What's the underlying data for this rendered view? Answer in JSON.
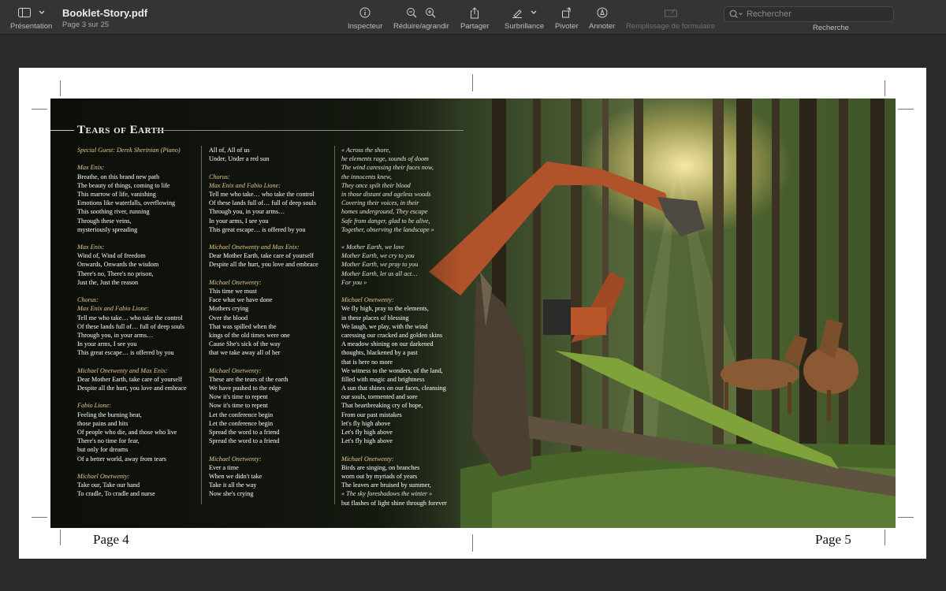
{
  "toolbar": {
    "presentation_label": "Présentation",
    "doc_title": "Booklet-Story.pdf",
    "doc_subtitle": "Page 3 sur 25",
    "inspector_label": "Inspecteur",
    "zoom_label": "Réduire/agrandir",
    "share_label": "Partager",
    "highlight_label": "Surbrillance",
    "rotate_label": "Pivoter",
    "annotate_label": "Annoter",
    "form_label": "Remplissage de formulaire",
    "search_placeholder": "Rechercher",
    "search_label": "Recherche"
  },
  "spread": {
    "title": "Tears of Earth",
    "col1": [
      {
        "t": "Special Guest: Derek Sherinian (Piano)",
        "s": "it"
      },
      {
        "t": "",
        "s": "gap"
      },
      {
        "t": "Max Enix:",
        "s": "it"
      },
      {
        "t": "Breathe, on this brand new path",
        "s": ""
      },
      {
        "t": "The beauty of things, coming to life",
        "s": ""
      },
      {
        "t": "This marrow of life, vanishing",
        "s": ""
      },
      {
        "t": "Emotions like waterfalls, overflowing",
        "s": ""
      },
      {
        "t": "This soothing river, running",
        "s": ""
      },
      {
        "t": "Through these veins,",
        "s": ""
      },
      {
        "t": "mysteriously spreading",
        "s": ""
      },
      {
        "t": "",
        "s": "gap"
      },
      {
        "t": "Max Enix:",
        "s": "it"
      },
      {
        "t": "Wind of, Wind of freedom",
        "s": ""
      },
      {
        "t": "Onwards, Onwards the wisdom",
        "s": ""
      },
      {
        "t": "There's no, There's no prison,",
        "s": ""
      },
      {
        "t": "Just the, Just the reason",
        "s": ""
      },
      {
        "t": "",
        "s": "gap"
      },
      {
        "t": "Chorus:",
        "s": "it"
      },
      {
        "t": "Max Enix and Fabio Lione:",
        "s": "it"
      },
      {
        "t": "Tell me who take… who take the control",
        "s": ""
      },
      {
        "t": "Of these lands full of… full of deep souls",
        "s": ""
      },
      {
        "t": "Through you, in your arms…",
        "s": ""
      },
      {
        "t": "In your arms, I see you",
        "s": ""
      },
      {
        "t": "This great escape… is offered by you",
        "s": ""
      },
      {
        "t": "",
        "s": "gap"
      },
      {
        "t": "Michael Onetwenty and Max Enix:",
        "s": "it"
      },
      {
        "t": "Dear Mother Earth, take care of yourself",
        "s": ""
      },
      {
        "t": "Despite all the hurt, you love and embrace",
        "s": ""
      },
      {
        "t": "",
        "s": "gap"
      },
      {
        "t": "Fabio Lione:",
        "s": "it"
      },
      {
        "t": "Feeling the burning heat,",
        "s": ""
      },
      {
        "t": "those pains and hits",
        "s": ""
      },
      {
        "t": "Of people who die, and those who live",
        "s": ""
      },
      {
        "t": "There's no time for fear,",
        "s": ""
      },
      {
        "t": "but only for dreams",
        "s": ""
      },
      {
        "t": "Of a better world, away from tears",
        "s": ""
      },
      {
        "t": "",
        "s": "gap"
      },
      {
        "t": "Michael Onetwenty:",
        "s": "it"
      },
      {
        "t": "Take our, Take our hand",
        "s": ""
      },
      {
        "t": "To cradle, To cradle and nurse",
        "s": ""
      }
    ],
    "col2": [
      {
        "t": "All of, All of us",
        "s": ""
      },
      {
        "t": "Under, Under a red sun",
        "s": ""
      },
      {
        "t": "",
        "s": "gap"
      },
      {
        "t": "Chorus:",
        "s": "it"
      },
      {
        "t": "Max Enix and Fabio Lione:",
        "s": "it"
      },
      {
        "t": "Tell me who take… who take the control",
        "s": ""
      },
      {
        "t": "Of these lands full of… full of deep souls",
        "s": ""
      },
      {
        "t": "Through you, in your arms…",
        "s": ""
      },
      {
        "t": "In your arms, I see you",
        "s": ""
      },
      {
        "t": "This great escape… is offered by you",
        "s": ""
      },
      {
        "t": "",
        "s": "gap"
      },
      {
        "t": "Michael Onetwenty and Max Enix:",
        "s": "it"
      },
      {
        "t": "Dear Mother Earth, take care of yourself",
        "s": ""
      },
      {
        "t": "Despite all the hurt, you love and embrace",
        "s": ""
      },
      {
        "t": "",
        "s": "gap"
      },
      {
        "t": "Michael Onetwenty:",
        "s": "it"
      },
      {
        "t": "This time we must",
        "s": ""
      },
      {
        "t": "Face what we have done",
        "s": ""
      },
      {
        "t": "Mothers crying",
        "s": ""
      },
      {
        "t": "Over the blood",
        "s": ""
      },
      {
        "t": "That was spilled when the",
        "s": ""
      },
      {
        "t": "kings of the old times were one",
        "s": ""
      },
      {
        "t": "Cause She's sick of the way",
        "s": ""
      },
      {
        "t": "that we take away all of her",
        "s": ""
      },
      {
        "t": "",
        "s": "gap"
      },
      {
        "t": "Michael Onetwenty:",
        "s": "it"
      },
      {
        "t": "These are the tears of the earth",
        "s": ""
      },
      {
        "t": "We have pushed to the edge",
        "s": ""
      },
      {
        "t": "Now it's time to repent",
        "s": ""
      },
      {
        "t": "Now it's time to repent",
        "s": ""
      },
      {
        "t": "Let the conference begin",
        "s": ""
      },
      {
        "t": "Let the conference begin",
        "s": ""
      },
      {
        "t": "Spread the word to a friend",
        "s": ""
      },
      {
        "t": "Spread the word to a friend",
        "s": ""
      },
      {
        "t": "",
        "s": "gap"
      },
      {
        "t": "Michael Onetwenty:",
        "s": "it"
      },
      {
        "t": "Ever a time",
        "s": ""
      },
      {
        "t": "When we didn't take",
        "s": ""
      },
      {
        "t": "Take it all the way",
        "s": ""
      },
      {
        "t": "Now she's crying",
        "s": ""
      }
    ],
    "col3": [
      {
        "t": "« Across the shore,",
        "s": "itw"
      },
      {
        "t": "he elements rage, sounds of doom",
        "s": "itw"
      },
      {
        "t": "The wind caressing their faces now,",
        "s": "itw"
      },
      {
        "t": "the innocents knew,",
        "s": "itw"
      },
      {
        "t": "They once spilt their blood",
        "s": "itw"
      },
      {
        "t": "in those distant and ageless woods",
        "s": "itw"
      },
      {
        "t": "Covering their voices, in their",
        "s": "itw"
      },
      {
        "t": "homes underground, They escape",
        "s": "itw"
      },
      {
        "t": "Safe from danger, glad to be alive,",
        "s": "itw"
      },
      {
        "t": "Together, observing the landscape »",
        "s": "itw"
      },
      {
        "t": "",
        "s": "gap"
      },
      {
        "t": "« Mother Earth, we love",
        "s": "itw"
      },
      {
        "t": "Mother Earth, we cry to you",
        "s": "itw"
      },
      {
        "t": "Mother Earth, we pray to you",
        "s": "itw"
      },
      {
        "t": "Mother Earth, let us all act…",
        "s": "itw"
      },
      {
        "t": "For you »",
        "s": "itw"
      },
      {
        "t": "",
        "s": "gap"
      },
      {
        "t": "Michael Onetwenty:",
        "s": "it"
      },
      {
        "t": "We fly high, pray to the elements,",
        "s": ""
      },
      {
        "t": "in these places of blessing",
        "s": ""
      },
      {
        "t": "We laugh, we play, with the wind",
        "s": ""
      },
      {
        "t": "caressing our cracked and golden skins",
        "s": ""
      },
      {
        "t": "A meadow shining on our darkened",
        "s": ""
      },
      {
        "t": "thoughts, blackened by a past",
        "s": ""
      },
      {
        "t": "that is here no more",
        "s": ""
      },
      {
        "t": "We witness to the wonders, of the land,",
        "s": ""
      },
      {
        "t": "filled with magic and brightness",
        "s": ""
      },
      {
        "t": "A sun that shines on our faces, cleansing",
        "s": ""
      },
      {
        "t": "our souls, tormented and sore",
        "s": ""
      },
      {
        "t": "That heartbreaking cry of hope,",
        "s": ""
      },
      {
        "t": "From our past mistakes",
        "s": ""
      },
      {
        "t": "let's fly high above",
        "s": ""
      },
      {
        "t": "Let's fly high above",
        "s": ""
      },
      {
        "t": "Let's fly high above",
        "s": ""
      },
      {
        "t": "",
        "s": "gap"
      },
      {
        "t": "Michael Onetwenty:",
        "s": "it"
      },
      {
        "t": "Birds are singing, on branches",
        "s": ""
      },
      {
        "t": "worn out by myriads of years",
        "s": ""
      },
      {
        "t": "The leaves are bruised by summer,",
        "s": ""
      },
      {
        "t": "« The sky foreshadows the winter »",
        "s": "itw"
      },
      {
        "t": "but flashes of light shine through forever",
        "s": ""
      }
    ]
  },
  "page_left": "Page 4",
  "page_right": "Page 5"
}
